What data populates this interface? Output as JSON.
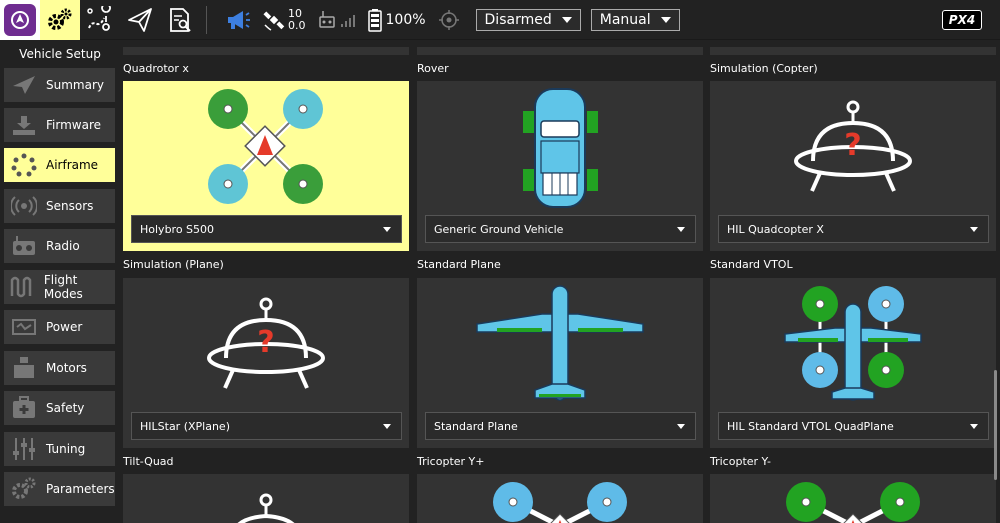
{
  "toolbar": {
    "satellites": "10",
    "hdop": "0.0",
    "battery": "100%",
    "arm_state": "Disarmed",
    "flight_mode": "Manual",
    "brand": "PX4",
    "active_color": "#ffff99"
  },
  "sidebar": {
    "title": "Vehicle Setup",
    "items": [
      {
        "label": "Summary",
        "icon": "paper-plane-icon"
      },
      {
        "label": "Firmware",
        "icon": "firmware-download-icon"
      },
      {
        "label": "Airframe",
        "icon": "airframe-icon"
      },
      {
        "label": "Sensors",
        "icon": "sensors-icon"
      },
      {
        "label": "Radio",
        "icon": "radio-icon"
      },
      {
        "label": "Flight Modes",
        "icon": "flight-modes-icon"
      },
      {
        "label": "Power",
        "icon": "power-icon"
      },
      {
        "label": "Motors",
        "icon": "motors-icon"
      },
      {
        "label": "Safety",
        "icon": "safety-icon"
      },
      {
        "label": "Tuning",
        "icon": "tuning-icon"
      },
      {
        "label": "Parameters",
        "icon": "parameters-icon"
      }
    ]
  },
  "airframes": [
    {
      "group": "Quadrotor x",
      "selected": "Holybro S500"
    },
    {
      "group": "Rover",
      "selected": "Generic Ground Vehicle"
    },
    {
      "group": "Simulation (Copter)",
      "selected": "HIL Quadcopter X"
    },
    {
      "group": "Simulation (Plane)",
      "selected": "HILStar (XPlane)"
    },
    {
      "group": "Standard Plane",
      "selected": "Standard Plane"
    },
    {
      "group": "Standard VTOL",
      "selected": "HIL Standard VTOL QuadPlane"
    },
    {
      "group": "Tilt-Quad"
    },
    {
      "group": "Tricopter Y+"
    },
    {
      "group": "Tricopter Y-"
    }
  ]
}
